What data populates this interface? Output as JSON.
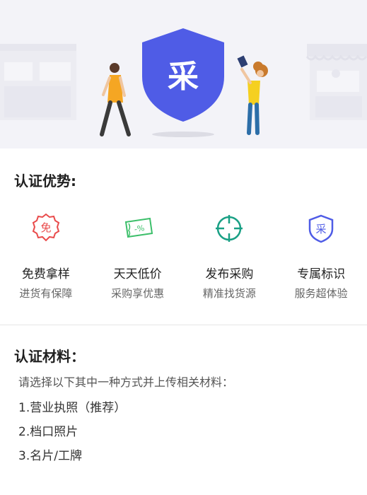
{
  "hero": {
    "badge_char": "采",
    "colors": {
      "shield": "#4f5ce6",
      "background": "#f3f3f8"
    }
  },
  "advantages": {
    "title": "认证优势:",
    "items": [
      {
        "icon": "free-sample-badge-icon",
        "title": "免费拿样",
        "subtitle": "进货有保障",
        "icon_text": "免",
        "color": "#e94b4b"
      },
      {
        "icon": "discount-ticket-icon",
        "title": "天天低价",
        "subtitle": "采购享优惠",
        "icon_text": "-%",
        "color": "#3cbf6a"
      },
      {
        "icon": "crosshair-target-icon",
        "title": "发布采购",
        "subtitle": "精准找货源",
        "icon_text": "",
        "color": "#1aa085"
      },
      {
        "icon": "shield-badge-icon",
        "title": "专属标识",
        "subtitle": "服务超体验",
        "icon_text": "采",
        "color": "#4f5ce6"
      }
    ]
  },
  "materials": {
    "title": "认证材料：",
    "description": "请选择以下其中一种方式并上传相关材料：",
    "items": [
      "1.营业执照（推荐）",
      "2.档口照片",
      "3.名片/工牌"
    ]
  }
}
